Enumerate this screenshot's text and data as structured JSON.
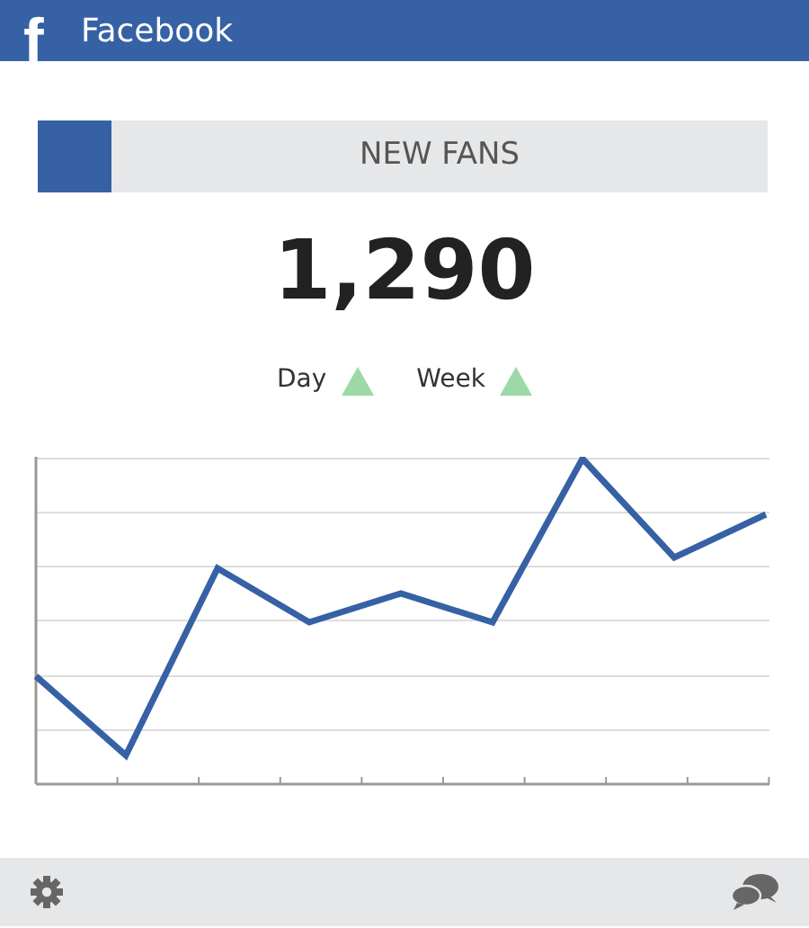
{
  "header": {
    "logo": "f",
    "title": "Facebook"
  },
  "metric": {
    "label": "NEW FANS",
    "value": "1,290"
  },
  "trends": [
    {
      "label": "Day",
      "rising": true
    },
    {
      "label": "Week",
      "rising": true
    }
  ]
}
